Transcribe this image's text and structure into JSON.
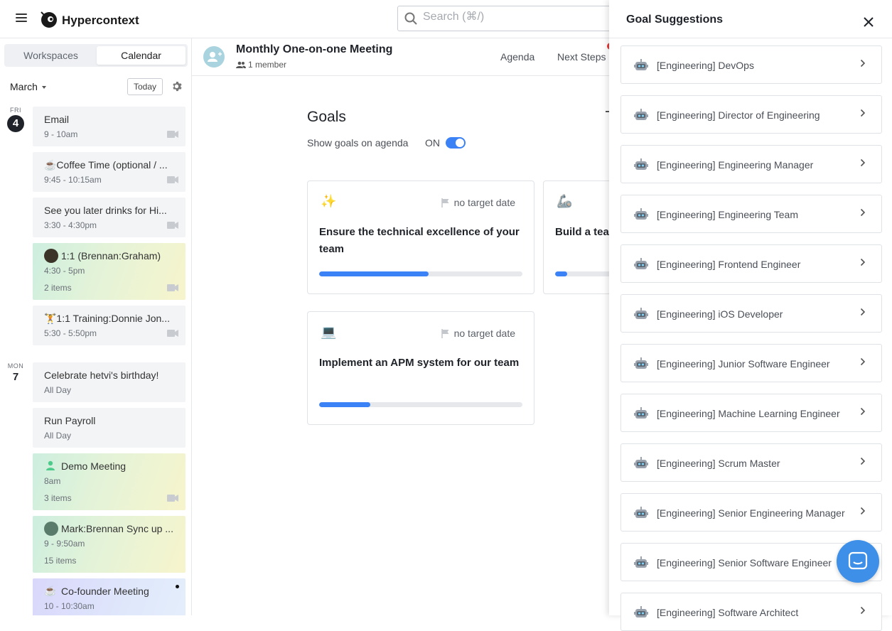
{
  "app": {
    "name": "Hypercontext"
  },
  "search": {
    "placeholder": "Search (⌘/)"
  },
  "sidebar": {
    "tabs": [
      "Workspaces",
      "Calendar"
    ],
    "month": "March",
    "today_label": "Today",
    "days": [
      {
        "weekday": "FRI",
        "day": "4"
      },
      {
        "weekday": "MON",
        "day": "7"
      }
    ],
    "events": [
      {
        "title": "Email",
        "time": "9 - 10am"
      },
      {
        "title": "☕Coffee Time (optional / ...",
        "time": "9:45 - 10:15am"
      },
      {
        "title": "See you later drinks for Hi...",
        "time": "3:30 - 4:30pm"
      },
      {
        "title": "1:1 (Brennan:Graham)",
        "time": "4:30 - 5pm",
        "items": "2 items"
      },
      {
        "title": "🏋1:1 Training:Donnie Jon...",
        "time": "5:30 - 5:50pm"
      },
      {
        "title": "Celebrate hetvi's birthday!",
        "time": "All Day"
      },
      {
        "title": "Run Payroll",
        "time": "All Day"
      },
      {
        "title": "Demo Meeting",
        "time": "8am",
        "items": "3 items"
      },
      {
        "title": "Mark:Brennan Sync up ...",
        "time": "9 - 9:50am",
        "items": "15 items"
      },
      {
        "title": "Co-founder Meeting",
        "time": "10 - 10:30am"
      }
    ]
  },
  "meeting": {
    "title": "Monthly One-on-one Meeting",
    "members": "1 member",
    "tabs": [
      "Agenda",
      "Next Steps"
    ]
  },
  "goals": {
    "heading": "Goals",
    "show_label": "Show goals on agenda",
    "toggle_label": "ON",
    "cards": [
      {
        "emoji": "✨",
        "target": "no target date",
        "title": "Ensure the technical excellence of your team",
        "progress": 0.54
      },
      {
        "emoji": "🦾",
        "target": "",
        "title": "Build a team of engineers",
        "progress": 0.2
      },
      {
        "emoji": "💻",
        "target": "no target date",
        "title": "Implement an APM system for our team",
        "progress": 0.25
      }
    ]
  },
  "panel": {
    "title": "Goal Suggestions",
    "suggestions": [
      "[Engineering] DevOps",
      "[Engineering] Director of Engineering",
      "[Engineering] Engineering Manager",
      "[Engineering] Engineering Team",
      "[Engineering] Frontend Engineer",
      "[Engineering] iOS Developer",
      "[Engineering] Junior Software Engineer",
      "[Engineering] Machine Learning Engineer",
      "[Engineering] Scrum Master",
      "[Engineering] Senior Engineering Manager",
      "[Engineering] Senior Software Engineer",
      "[Engineering] Software Architect"
    ]
  },
  "colors": {
    "accent": "#3b82f6",
    "chat": "#3d8fe8"
  }
}
